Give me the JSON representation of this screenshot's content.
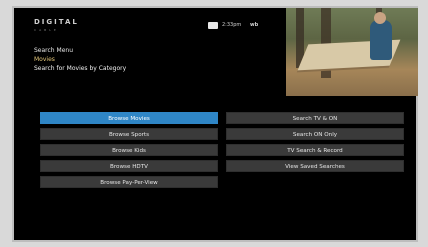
{
  "app": {
    "brand": "DIGITAL",
    "brand_subtitle": "CABLE",
    "status": {
      "mail_icon": "mail-icon",
      "clock": "2:33pm",
      "channel": "wb"
    }
  },
  "breadcrumb": {
    "line1": "Search Menu",
    "line2": "Movies",
    "line3": "Search for Movies by Category"
  },
  "menus": {
    "left": [
      {
        "label": "Browse Movies",
        "active": true
      },
      {
        "label": "Browse Sports",
        "active": false
      },
      {
        "label": "Browse Kids",
        "active": false
      },
      {
        "label": "Browse HDTV",
        "active": false
      },
      {
        "label": "Browse Pay-Per-View",
        "active": false
      }
    ],
    "right": [
      {
        "label": "Search TV & ON",
        "active": false
      },
      {
        "label": "Search ON Only",
        "active": false
      },
      {
        "label": "TV Search & Record",
        "active": false
      },
      {
        "label": "View Saved Searches",
        "active": false
      }
    ]
  },
  "colors": {
    "active_button": "#2f86c6",
    "button": "#3a3a3a",
    "background": "#000000"
  }
}
